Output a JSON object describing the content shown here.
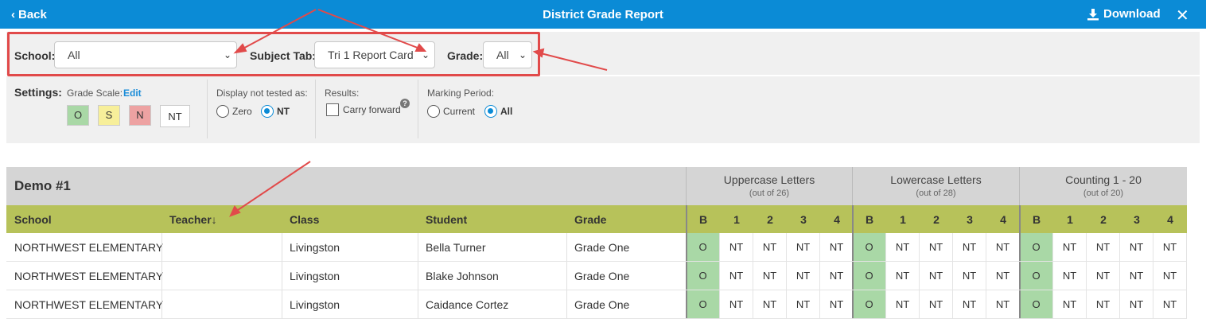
{
  "header": {
    "back_label": "Back",
    "title": "District Grade Report",
    "download_label": "Download",
    "close_symbol": "✕"
  },
  "filters": {
    "school_label": "School:",
    "school_value": "All",
    "subject_label": "Subject Tab:",
    "subject_value": "Tri 1 Report Card",
    "grade_label": "Grade:",
    "grade_value": "All"
  },
  "settings": {
    "label": "Settings:",
    "grade_scale_label": "Grade Scale:",
    "edit_label": "Edit",
    "scale_chips": [
      {
        "label": "O",
        "color": "#a9d8a6"
      },
      {
        "label": "S",
        "color": "#f7ef9a"
      },
      {
        "label": "N",
        "color": "#eda2a2"
      },
      {
        "label": "NT",
        "color": "#ffffff"
      }
    ],
    "display_not_tested_label": "Display not tested as:",
    "zero_label": "Zero",
    "nt_label": "NT",
    "results_label": "Results:",
    "carry_forward_label": "Carry forward",
    "help_symbol": "?",
    "marking_period_label": "Marking Period:",
    "current_label": "Current",
    "all_label": "All"
  },
  "table": {
    "group_title": "Demo #1",
    "columns": [
      "School",
      "Teacher",
      "Class",
      "Student",
      "Grade"
    ],
    "sort_arrow": "↓",
    "groups": [
      {
        "name": "Uppercase Letters",
        "sub": "(out of 26)"
      },
      {
        "name": "Lowercase Letters",
        "sub": "(out of 28)"
      },
      {
        "name": "Counting 1 - 20",
        "sub": "(out of 20)"
      }
    ],
    "period_cols": [
      "B",
      "1",
      "2",
      "3",
      "4"
    ],
    "rows": [
      {
        "school": "NORTHWEST ELEMENTARY",
        "teacher": "",
        "class": "Livingston",
        "student": "Bella Turner",
        "grade": "Grade One",
        "scores": [
          "O",
          "NT",
          "NT",
          "NT",
          "NT",
          "O",
          "NT",
          "NT",
          "NT",
          "NT",
          "O",
          "NT",
          "NT",
          "NT",
          "NT"
        ]
      },
      {
        "school": "NORTHWEST ELEMENTARY",
        "teacher": "",
        "class": "Livingston",
        "student": "Blake Johnson",
        "grade": "Grade One",
        "scores": [
          "O",
          "NT",
          "NT",
          "NT",
          "NT",
          "O",
          "NT",
          "NT",
          "NT",
          "NT",
          "O",
          "NT",
          "NT",
          "NT",
          "NT"
        ]
      },
      {
        "school": "NORTHWEST ELEMENTARY",
        "teacher": "",
        "class": "Livingston",
        "student": "Caidance Cortez",
        "grade": "Grade One",
        "scores": [
          "O",
          "NT",
          "NT",
          "NT",
          "NT",
          "O",
          "NT",
          "NT",
          "NT",
          "NT",
          "O",
          "NT",
          "NT",
          "NT",
          "NT"
        ]
      }
    ]
  },
  "colors": {
    "header_bg": "#0b8bd6",
    "column_header_bg": "#b7c25a",
    "score_o": "#a9d8a6",
    "annotation_red": "#e14a4a"
  }
}
